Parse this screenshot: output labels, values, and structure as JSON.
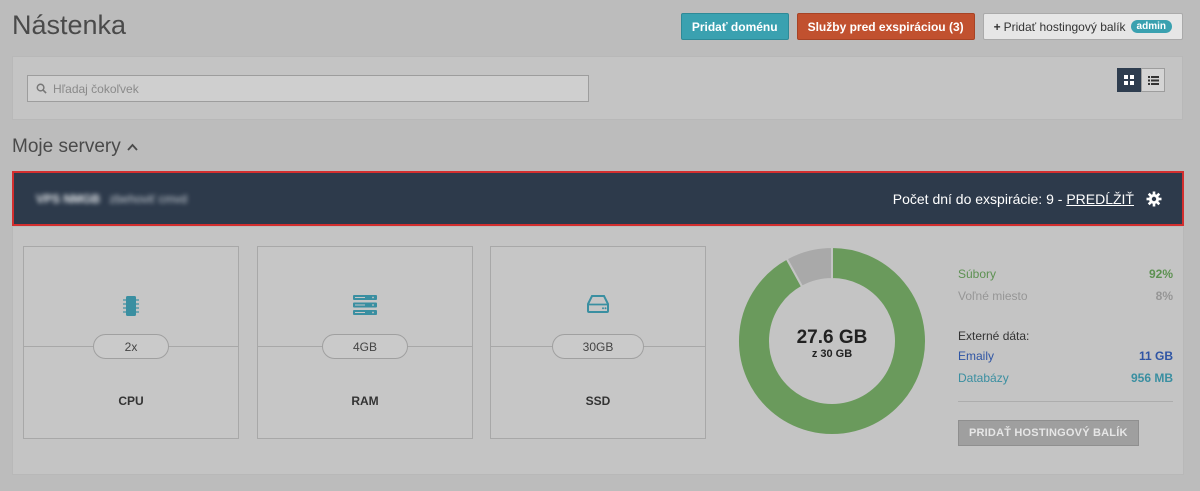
{
  "page": {
    "title": "Nástenka"
  },
  "header_actions": {
    "add_domain": "Pridať doménu",
    "expiring_services": "Služby pred exspiráciou (3)",
    "add_hosting": "Pridať hostingový balík",
    "admin_badge": "admin"
  },
  "search": {
    "placeholder": "Hľadaj čokoľvek"
  },
  "view_toggle": {
    "active": "grid",
    "icons": [
      "grid-view-icon",
      "list-view-icon"
    ]
  },
  "servers_section": {
    "title": "Moje servery"
  },
  "server": {
    "name": "VPS NMGB",
    "subtitle": "zbehoviť cmvd",
    "expiry_label": "Počet dní do exspirácie: 9 -",
    "renew_label": "PREDĹŽIŤ"
  },
  "specs": [
    {
      "value": "2x",
      "label": "CPU",
      "icon": "cpu-icon"
    },
    {
      "value": "4GB",
      "label": "RAM",
      "icon": "server-rack-icon"
    },
    {
      "value": "30GB",
      "label": "SSD",
      "icon": "hard-drive-icon"
    }
  ],
  "storage": {
    "used": "27.6 GB",
    "total": "z 30 GB",
    "files_pct": 92,
    "free_pct": 8
  },
  "usage": {
    "files_label": "Súbory",
    "files_value": "92%",
    "free_label": "Voľné miesto",
    "free_value": "8%",
    "external_title": "Externé dáta:",
    "emails_label": "Emaily",
    "emails_value": "11 GB",
    "databases_label": "Databázy",
    "databases_value": "956 MB",
    "add_package_button": "PRIDAŤ HOSTINGOVÝ BALÍK"
  },
  "colors": {
    "files": "#6a9a5c",
    "free": "#a9a9a9",
    "server_bar": "#2d3a4b",
    "accent_info": "#3aa1b0",
    "accent_danger": "#c1512f"
  }
}
